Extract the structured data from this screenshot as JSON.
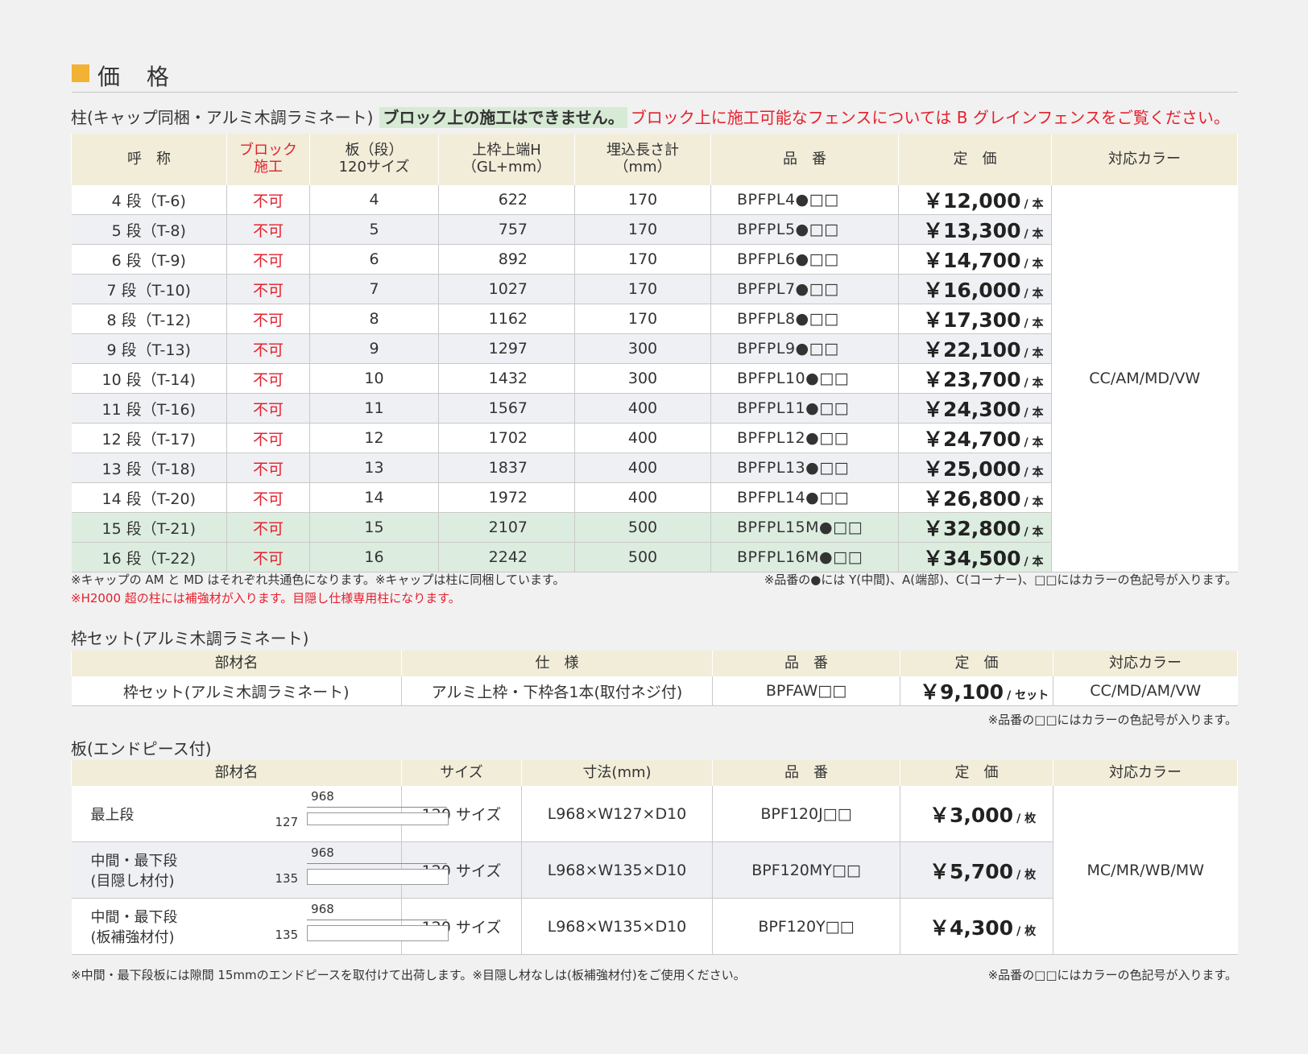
{
  "header": {
    "title": "価 格"
  },
  "section1": {
    "title": "柱(キャップ同梱・アルミ木調ラミネート)",
    "highlight": "ブロック上の施工はできません。",
    "red_text": "ブロック上に施工可能なフェンスについては B グレインフェンスをご覧ください。",
    "columns": [
      "呼　称",
      "ブロック施工",
      "板（段）120サイズ",
      "上枠上端H（GL+mm）",
      "埋込長さ計（mm）",
      "品　番",
      "定　価",
      "対応カラー"
    ],
    "rows": [
      {
        "name": "4 段（T-6)",
        "block": "不可",
        "boards": "4",
        "height": "622",
        "embed": "170",
        "code": "BPFPL4●□□",
        "price": "￥12,000",
        "unit": "/ 本"
      },
      {
        "name": "5 段（T-8)",
        "block": "不可",
        "boards": "5",
        "height": "757",
        "embed": "170",
        "code": "BPFPL5●□□",
        "price": "￥13,300",
        "unit": "/ 本"
      },
      {
        "name": "6 段（T-9)",
        "block": "不可",
        "boards": "6",
        "height": "892",
        "embed": "170",
        "code": "BPFPL6●□□",
        "price": "￥14,700",
        "unit": "/ 本"
      },
      {
        "name": "7 段（T-10)",
        "block": "不可",
        "boards": "7",
        "height": "1027",
        "embed": "170",
        "code": "BPFPL7●□□",
        "price": "￥16,000",
        "unit": "/ 本"
      },
      {
        "name": "8 段（T-12)",
        "block": "不可",
        "boards": "8",
        "height": "1162",
        "embed": "170",
        "code": "BPFPL8●□□",
        "price": "￥17,300",
        "unit": "/ 本"
      },
      {
        "name": "9 段（T-13)",
        "block": "不可",
        "boards": "9",
        "height": "1297",
        "embed": "300",
        "code": "BPFPL9●□□",
        "price": "￥22,100",
        "unit": "/ 本"
      },
      {
        "name": "10 段（T-14)",
        "block": "不可",
        "boards": "10",
        "height": "1432",
        "embed": "300",
        "code": "BPFPL10●□□",
        "price": "￥23,700",
        "unit": "/ 本"
      },
      {
        "name": "11 段（T-16)",
        "block": "不可",
        "boards": "11",
        "height": "1567",
        "embed": "400",
        "code": "BPFPL11●□□",
        "price": "￥24,300",
        "unit": "/ 本"
      },
      {
        "name": "12 段（T-17)",
        "block": "不可",
        "boards": "12",
        "height": "1702",
        "embed": "400",
        "code": "BPFPL12●□□",
        "price": "￥24,700",
        "unit": "/ 本"
      },
      {
        "name": "13 段（T-18)",
        "block": "不可",
        "boards": "13",
        "height": "1837",
        "embed": "400",
        "code": "BPFPL13●□□",
        "price": "￥25,000",
        "unit": "/ 本"
      },
      {
        "name": "14 段（T-20)",
        "block": "不可",
        "boards": "14",
        "height": "1972",
        "embed": "400",
        "code": "BPFPL14●□□",
        "price": "￥26,800",
        "unit": "/ 本"
      },
      {
        "name": "15 段（T-21)",
        "block": "不可",
        "boards": "15",
        "height": "2107",
        "embed": "500",
        "code": "BPFPL15M●□□",
        "price": "￥32,800",
        "unit": "/ 本"
      },
      {
        "name": "16 段（T-22)",
        "block": "不可",
        "boards": "16",
        "height": "2242",
        "embed": "500",
        "code": "BPFPL16M●□□",
        "price": "￥34,500",
        "unit": "/ 本"
      }
    ],
    "colors": "CC/AM/MD/VW",
    "note_left": "※キャップの AM と MD はそれぞれ共通色になります。※キャップは柱に同梱しています。",
    "note_right": "※品番の●には Y(中間)、A(端部)、C(コーナー)、□□にはカラーの色記号が入ります。",
    "note_red": "※H2000 超の柱には補強材が入ります。目隠し仕様専用柱になります。"
  },
  "section2": {
    "title": "枠セット(アルミ木調ラミネート)",
    "columns": [
      "部材名",
      "仕　様",
      "品　番",
      "定　価",
      "対応カラー"
    ],
    "row": {
      "name": "枠セット(アルミ木調ラミネート)",
      "spec": "アルミ上枠・下枠各1本(取付ネジ付)",
      "code": "BPFAW□□",
      "price": "￥9,100",
      "unit": "/ セット",
      "colors": "CC/MD/AM/VW"
    },
    "note": "※品番の□□にはカラーの色記号が入ります。"
  },
  "section3": {
    "title": "板(エンドピース付)",
    "columns": [
      "部材名",
      "サイズ",
      "寸法(mm)",
      "品　番",
      "定　価",
      "対応カラー"
    ],
    "rows": [
      {
        "name1": "最上段",
        "name2": "",
        "width": "968",
        "height": "127",
        "size": "120 サイズ",
        "dim": "L968×W127×D10",
        "code": "BPF120J□□",
        "price": "￥3,000",
        "unit": "/ 枚"
      },
      {
        "name1": "中間・最下段",
        "name2": "(目隠し材付)",
        "width": "968",
        "height": "135",
        "size": "120 サイズ",
        "dim": "L968×W135×D10",
        "code": "BPF120MY□□",
        "price": "￥5,700",
        "unit": "/ 枚"
      },
      {
        "name1": "中間・最下段",
        "name2": "(板補強材付)",
        "width": "968",
        "height": "135",
        "size": "120 サイズ",
        "dim": "L968×W135×D10",
        "code": "BPF120Y□□",
        "price": "￥4,300",
        "unit": "/ 枚"
      }
    ],
    "colors": "MC/MR/WB/MW",
    "note_left": "※中間・最下段板には隙間 15mmのエンドピースを取付けて出荷します。※目隠し材なしは(板補強材付)をご使用ください。",
    "note_right": "※品番の□□にはカラーの色記号が入ります。"
  },
  "theme": {
    "accent": "#f2b233",
    "header_bg": "#f1edd9",
    "red": "#e5202e",
    "green_row": "#dcede0",
    "alt_row": "#eff0f3"
  }
}
